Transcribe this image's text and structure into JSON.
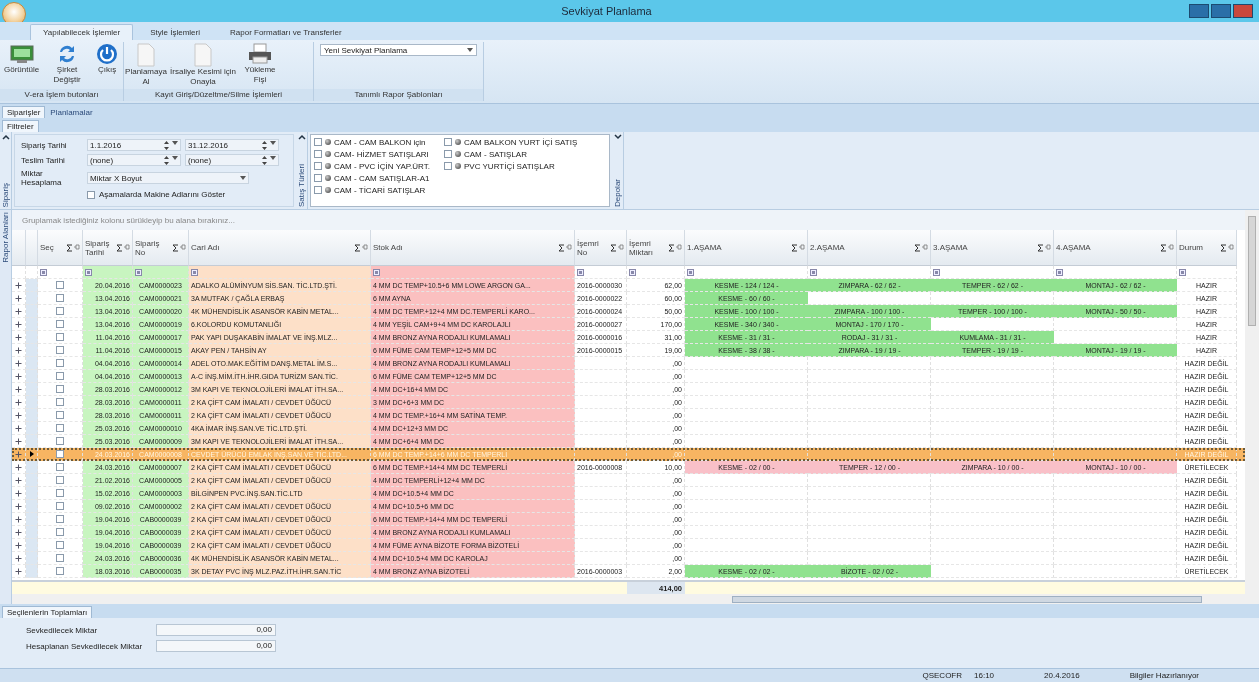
{
  "window": {
    "title": "Sevkiyat Planlama"
  },
  "ribbon": {
    "tabs": [
      {
        "label": "Yapılabilecek İşlemler",
        "selected": true
      },
      {
        "label": "Style İşlemleri",
        "selected": false
      },
      {
        "label": "Rapor Formatları ve Transferler",
        "selected": false
      }
    ],
    "groups": [
      {
        "kind": "buttons",
        "label": "V-era İşlem butonları",
        "buttons": [
          {
            "label": "Görüntüle"
          },
          {
            "label": "Şirket Değiştir"
          },
          {
            "label": "Çıkış"
          }
        ]
      },
      {
        "kind": "buttons",
        "label": "Kayıt Giriş/Düzeltme/Silme İşlemleri",
        "buttons": [
          {
            "label": "Planlamaya Al"
          },
          {
            "label": "İrsaliye Kesimi için Onayla"
          },
          {
            "label": "Yükleme Fişi"
          }
        ]
      },
      {
        "kind": "dropdown",
        "label": "Tanımlı Rapor Şablonları",
        "value": "Yeni Sevkiyat Planlama"
      }
    ]
  },
  "view_tabs": [
    {
      "label": "Siparişler",
      "selected": true
    },
    {
      "label": "Planlamalar",
      "selected": false
    }
  ],
  "sub_tab": "Filtreler",
  "filters": {
    "side_label": "Sipariş",
    "date_fields": [
      {
        "label": "Sipariş Tarihi",
        "from": "1.1.2016",
        "to": "31.12.2016"
      },
      {
        "label": "Teslim Tarihi",
        "from": "(none)",
        "to": "(none)"
      }
    ],
    "quantity": {
      "label": "Miktar Hesaplama",
      "value": "Miktar X Boyut"
    },
    "option": {
      "label": "Aşamalarda Makine Adlarını Göster",
      "checked": false
    },
    "sales_types": {
      "label": "Satış Türleri",
      "items": [
        {
          "label": "CAM - CAM BALKON için",
          "checked": false
        },
        {
          "label": "CAM- HİZMET SATIŞLARI",
          "checked": false
        },
        {
          "label": "CAM - PVC İÇİN YAP.ÜRT.",
          "checked": false
        },
        {
          "label": "CAM - CAM SATIŞLAR-A1",
          "checked": false
        },
        {
          "label": "CAM - TİCARİ SATIŞLAR",
          "checked": false
        },
        {
          "label": "CAM BALKON YURT İÇİ SATIŞ",
          "checked": false
        },
        {
          "label": "CAM  -  SATIŞLAR",
          "checked": false
        },
        {
          "label": "PVC YURTİÇİ SATIŞLAR",
          "checked": false
        }
      ]
    },
    "depots_label": "Depolar"
  },
  "report_fields_label": "Rapor Alanları",
  "group_hint": "Gruplamak istediğiniz kolonu sürükleyip bu alana bırakınız...",
  "grid": {
    "columns": [
      "Seç",
      "Sipariş Tarihi",
      "Sipariş No",
      "Cari Adı",
      "Stok Adı",
      "İşemri No",
      "İşemri Miktarı",
      "1.AŞAMA",
      "2.AŞAMA",
      "3.AŞAMA",
      "4.AŞAMA",
      "Durum"
    ],
    "rows": [
      {
        "selected": false,
        "checked": false,
        "date": "20.04.2016",
        "no": "CAM0000023",
        "customer": "ADALKO ALÜMİNYUM SİS.SAN. TİC.LTD.ŞTİ.",
        "stock": "4 MM DC TEMP+10.5+6 MM LOWE ARGON GA...",
        "work_order": "2016-0000030",
        "qty": "62,00",
        "stages": [
          {
            "kind": "done",
            "text": "KESME - 124 / 124 -"
          },
          {
            "kind": "done",
            "text": "ZIMPARA - 62 / 62 -"
          },
          {
            "kind": "done",
            "text": "TEMPER - 62 / 62 -"
          },
          {
            "kind": "done",
            "text": "MONTAJ - 62 / 62 -"
          }
        ],
        "status": "HAZIR"
      },
      {
        "selected": false,
        "checked": false,
        "date": "13.04.2016",
        "no": "CAM0000021",
        "customer": "3A MUTFAK / ÇAĞLA ERBAŞ",
        "stock": "6 MM AYNA",
        "work_order": "2016-0000022",
        "qty": "60,00",
        "stages": [
          {
            "kind": "done",
            "text": "KESME - 60 / 60 -"
          }
        ],
        "status": "HAZIR"
      },
      {
        "selected": false,
        "checked": false,
        "date": "13.04.2016",
        "no": "CAM0000020",
        "customer": "4K MÜHENDİSLİK ASANSÖR KABİN METAL...",
        "stock": "4 MM DC TEMP.+12+4 MM DC.TEMPERLİ KARO...",
        "work_order": "2016-0000024",
        "qty": "50,00",
        "stages": [
          {
            "kind": "done",
            "text": "KESME - 100 / 100 -"
          },
          {
            "kind": "done",
            "text": "ZIMPARA - 100 / 100 -"
          },
          {
            "kind": "done",
            "text": "TEMPER - 100 / 100 -"
          },
          {
            "kind": "done",
            "text": "MONTAJ - 50 / 50 -"
          }
        ],
        "status": "HAZIR"
      },
      {
        "selected": false,
        "checked": false,
        "date": "13.04.2016",
        "no": "CAM0000019",
        "customer": "6.KOLORDU KOMUTANLIĞI",
        "stock": "4 MM YEŞİL CAM+9+4 MM DC  KAROLAJLI",
        "work_order": "2016-0000027",
        "qty": "170,00",
        "stages": [
          {
            "kind": "done",
            "text": "KESME - 340 / 340 -"
          },
          {
            "kind": "done",
            "text": "MONTAJ - 170 / 170 -"
          }
        ],
        "status": "HAZIR"
      },
      {
        "selected": false,
        "checked": false,
        "date": "11.04.2016",
        "no": "CAM0000017",
        "customer": "PAK YAPI DUŞAKABİN İMALAT VE İNŞ.MLZ...",
        "stock": "4 MM BRONZ AYNA RODAJLI KUMLAMALI",
        "work_order": "2016-0000016",
        "qty": "31,00",
        "stages": [
          {
            "kind": "done",
            "text": "KESME - 31 / 31 -"
          },
          {
            "kind": "done",
            "text": "RODAJ - 31 / 31 -"
          },
          {
            "kind": "done",
            "text": "KUMLAMA - 31 / 31 -"
          }
        ],
        "status": "HAZIR"
      },
      {
        "selected": false,
        "checked": false,
        "date": "11.04.2016",
        "no": "CAM0000015",
        "customer": "AKAY PEN / TAHSİN AY",
        "stock": "6 MM FÜME CAM TEMP+12+5 MM DC",
        "work_order": "2016-0000015",
        "qty": "19,00",
        "stages": [
          {
            "kind": "done",
            "text": "KESME - 38 / 38 -"
          },
          {
            "kind": "done",
            "text": "ZIMPARA - 19 / 19 -"
          },
          {
            "kind": "done",
            "text": "TEMPER - 19 / 19 -"
          },
          {
            "kind": "done",
            "text": "MONTAJ - 19 / 19 -"
          }
        ],
        "status": "HAZIR"
      },
      {
        "selected": false,
        "checked": false,
        "date": "04.04.2016",
        "no": "CAM0000014",
        "customer": "ADEL OTO.MAK.EĞİTİM DANŞ.METAL İM.S...",
        "stock": "4 MM BRONZ AYNA RODAJLI KUMLAMALI",
        "qty": ",00",
        "stages": [],
        "status": "HAZIR DEĞİL"
      },
      {
        "selected": false,
        "checked": false,
        "date": "04.04.2016",
        "no": "CAM0000013",
        "customer": "A-C İNŞ.MİM.İTH.İHR.GIDA TURİZM SAN.TİC.",
        "stock": "6 MM FÜME CAM TEMP+12+5 MM DC",
        "qty": ",00",
        "stages": [],
        "status": "HAZIR DEĞİL"
      },
      {
        "selected": false,
        "checked": false,
        "date": "28.03.2016",
        "no": "CAM0000012",
        "customer": "3M KAPI VE TEKNOLOJİLERİ İMALAT İTH.SA...",
        "stock": "4 MM DC+16+4 MM DC",
        "qty": ",00",
        "stages": [],
        "status": "HAZIR DEĞİL"
      },
      {
        "selected": false,
        "checked": false,
        "date": "28.03.2016",
        "no": "CAM0000011",
        "customer": "2 KA ÇİFT CAM İMALATI / CEVDET ÜĞÜCÜ",
        "stock": "3 MM DC+6+3 MM DC",
        "qty": ",00",
        "stages": [],
        "status": "HAZIR DEĞİL"
      },
      {
        "selected": false,
        "checked": false,
        "date": "28.03.2016",
        "no": "CAM0000011",
        "customer": "2 KA ÇİFT CAM İMALATI / CEVDET ÜĞÜCÜ",
        "stock": "4 MM DC TEMP.+16+4 MM SATİNA TEMP.",
        "qty": ",00",
        "stages": [],
        "status": "HAZIR DEĞİL"
      },
      {
        "selected": false,
        "checked": false,
        "date": "25.03.2016",
        "no": "CAM0000010",
        "customer": "4KA İMAR İNŞ.SAN.VE TİC.LTD.ŞTİ.",
        "stock": "4 MM DC+12+3 MM DC",
        "qty": ",00",
        "stages": [],
        "status": "HAZIR DEĞİL"
      },
      {
        "selected": false,
        "checked": false,
        "date": "25.03.2016",
        "no": "CAM0000009",
        "customer": "3M KAPI VE TEKNOLOJİLERİ İMALAT İTH.SA...",
        "stock": "4 MM DC+6+4 MM DC",
        "qty": ",00",
        "stages": [],
        "status": "HAZIR DEĞİL"
      },
      {
        "selected": true,
        "checked": false,
        "date": "24.03.2016",
        "no": "CAM0000008",
        "customer": "CEVDET ÜRÜCÜ EMLAK İNŞ.SAN.VE TİC.LTD...",
        "stock": "6 MM DC TEMP.+14+6 MM DC TEMPERLİ",
        "qty": ",00",
        "stages": [],
        "status": "HAZIR DEĞİL"
      },
      {
        "selected": false,
        "checked": false,
        "date": "24.03.2016",
        "no": "CAM0000007",
        "customer": "2 KA ÇİFT CAM İMALATI / CEVDET ÜĞÜCÜ",
        "stock": "6 MM DC TEMP.+14+4 MM DC TEMPERLİ",
        "work_order": "2016-0000008",
        "qty": "10,00",
        "stages": [
          {
            "kind": "pending",
            "text": "KESME - 02 / 00 -"
          },
          {
            "kind": "pending",
            "text": "TEMPER - 12 / 00 -"
          },
          {
            "kind": "pending",
            "text": "ZIMPARA - 10 / 00 -"
          },
          {
            "kind": "pending",
            "text": "MONTAJ - 10 / 00 -"
          }
        ],
        "status": "ÜRETİLECEK"
      },
      {
        "selected": false,
        "checked": false,
        "date": "21.02.2016",
        "no": "CAM0000005",
        "customer": "2 KA ÇİFT CAM İMALATI / CEVDET ÜĞÜCÜ",
        "stock": "4 MM DC TEMPERLİ+12+4 MM DC",
        "qty": ",00",
        "stages": [],
        "status": "HAZIR DEĞİL"
      },
      {
        "selected": false,
        "checked": false,
        "date": "15.02.2016",
        "no": "CAM0000003",
        "customer": "BİLGİNPEN PVC.İNŞ.SAN.TİC.LTD",
        "stock": "4 MM DC+10.5+4 MM DC",
        "qty": ",00",
        "stages": [],
        "status": "HAZIR DEĞİL"
      },
      {
        "selected": false,
        "checked": false,
        "date": "09.02.2016",
        "no": "CAM0000002",
        "customer": "2 KA ÇİFT CAM İMALATI / CEVDET ÜĞÜCÜ",
        "stock": "4 MM DC+10.5+6 MM DC",
        "qty": ",00",
        "stages": [],
        "status": "HAZIR DEĞİL"
      },
      {
        "selected": false,
        "checked": false,
        "date": "19.04.2016",
        "no": "CAB0000039",
        "customer": "2 KA ÇİFT CAM İMALATI / CEVDET ÜĞÜCÜ",
        "stock": "6 MM DC TEMP.+14+4 MM DC TEMPERLİ",
        "qty": ",00",
        "stages": [],
        "status": "HAZIR DEĞİL"
      },
      {
        "selected": false,
        "checked": false,
        "date": "19.04.2016",
        "no": "CAB0000039",
        "customer": "2 KA ÇİFT CAM İMALATI / CEVDET ÜĞÜCÜ",
        "stock": "4 MM BRONZ AYNA RODAJLI KUMLAMALI",
        "qty": ",00",
        "stages": [],
        "status": "HAZIR DEĞİL"
      },
      {
        "selected": false,
        "checked": false,
        "date": "19.04.2016",
        "no": "CAB0000039",
        "customer": "2 KA ÇİFT CAM İMALATI / CEVDET ÜĞÜCÜ",
        "stock": "4 MM FÜME AYNA BİZOTE FORMA BİZOTELİ",
        "qty": ",00",
        "stages": [],
        "status": "HAZIR DEĞİL"
      },
      {
        "selected": false,
        "checked": false,
        "date": "24.03.2016",
        "no": "CAB0000036",
        "customer": "4K MÜHENDİSLİK ASANSÖR KABİN METAL...",
        "stock": "4 MM DC+10.5+4 MM DC KAROLAJ",
        "qty": ",00",
        "stages": [],
        "status": "HAZIR DEĞİL"
      },
      {
        "selected": false,
        "checked": false,
        "date": "18.03.2016",
        "no": "CAB0000035",
        "customer": "3K DETAY PVC İNŞ MLZ.PAZ.İTH.İHR.SAN.TİC",
        "stock": "4 MM BRONZ AYNA BİZOTELİ",
        "work_order": "2016-0000003",
        "qty": "2,00",
        "stages": [
          {
            "kind": "done",
            "text": "KESME - 02 / 02 -"
          },
          {
            "kind": "done",
            "text": "BİZOTE - 02 / 02 -"
          }
        ],
        "status": "ÜRETİLECEK"
      }
    ],
    "total": "414,00"
  },
  "totals": {
    "tab": "Seçilenlerin Toplamları",
    "fields": [
      {
        "label": "Sevkedilecek Miktar",
        "value": "0,00"
      },
      {
        "label": "Hesaplanan Sevkedilecek Miktar",
        "value": "0,00"
      }
    ]
  },
  "status_bar": [
    "QSECOFR",
    "16:10",
    "20.4.2016",
    "Bilgiler Hazırlanıyor"
  ]
}
